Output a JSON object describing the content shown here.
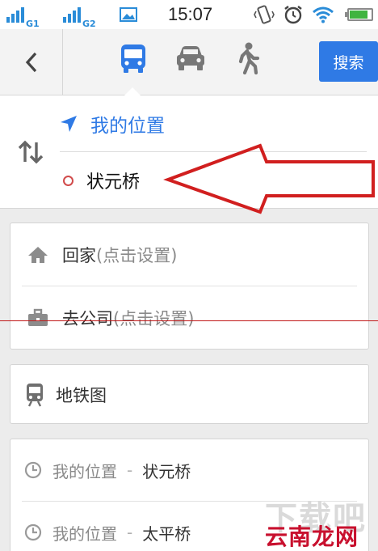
{
  "status_bar": {
    "time": "15:07",
    "sim1_label": "G1",
    "sim2_label": "G2",
    "battery_level": 0.85,
    "icons": [
      "signal-icon",
      "signal-icon",
      "image-icon",
      "vibrate-icon",
      "alarm-icon",
      "wifi-icon",
      "battery-icon"
    ]
  },
  "toolbar": {
    "modes": [
      "bus-icon",
      "car-icon",
      "walk-icon"
    ],
    "active_mode": "bus",
    "search_label": "搜索",
    "accent_color": "#2f7ae5"
  },
  "route": {
    "from": "我的位置",
    "to": "状元桥"
  },
  "shortcuts": {
    "home_label": "回家",
    "home_hint": "(点击设置)",
    "work_label": "去公司",
    "work_hint": "(点击设置)"
  },
  "subway": {
    "label": "地铁图"
  },
  "history": [
    {
      "from": "我的位置",
      "sep": "-",
      "to": "状元桥"
    },
    {
      "from": "我的位置",
      "sep": "-",
      "to": "太平桥"
    }
  ],
  "watermark": {
    "top": "下载吧",
    "site": "云南龙网"
  }
}
